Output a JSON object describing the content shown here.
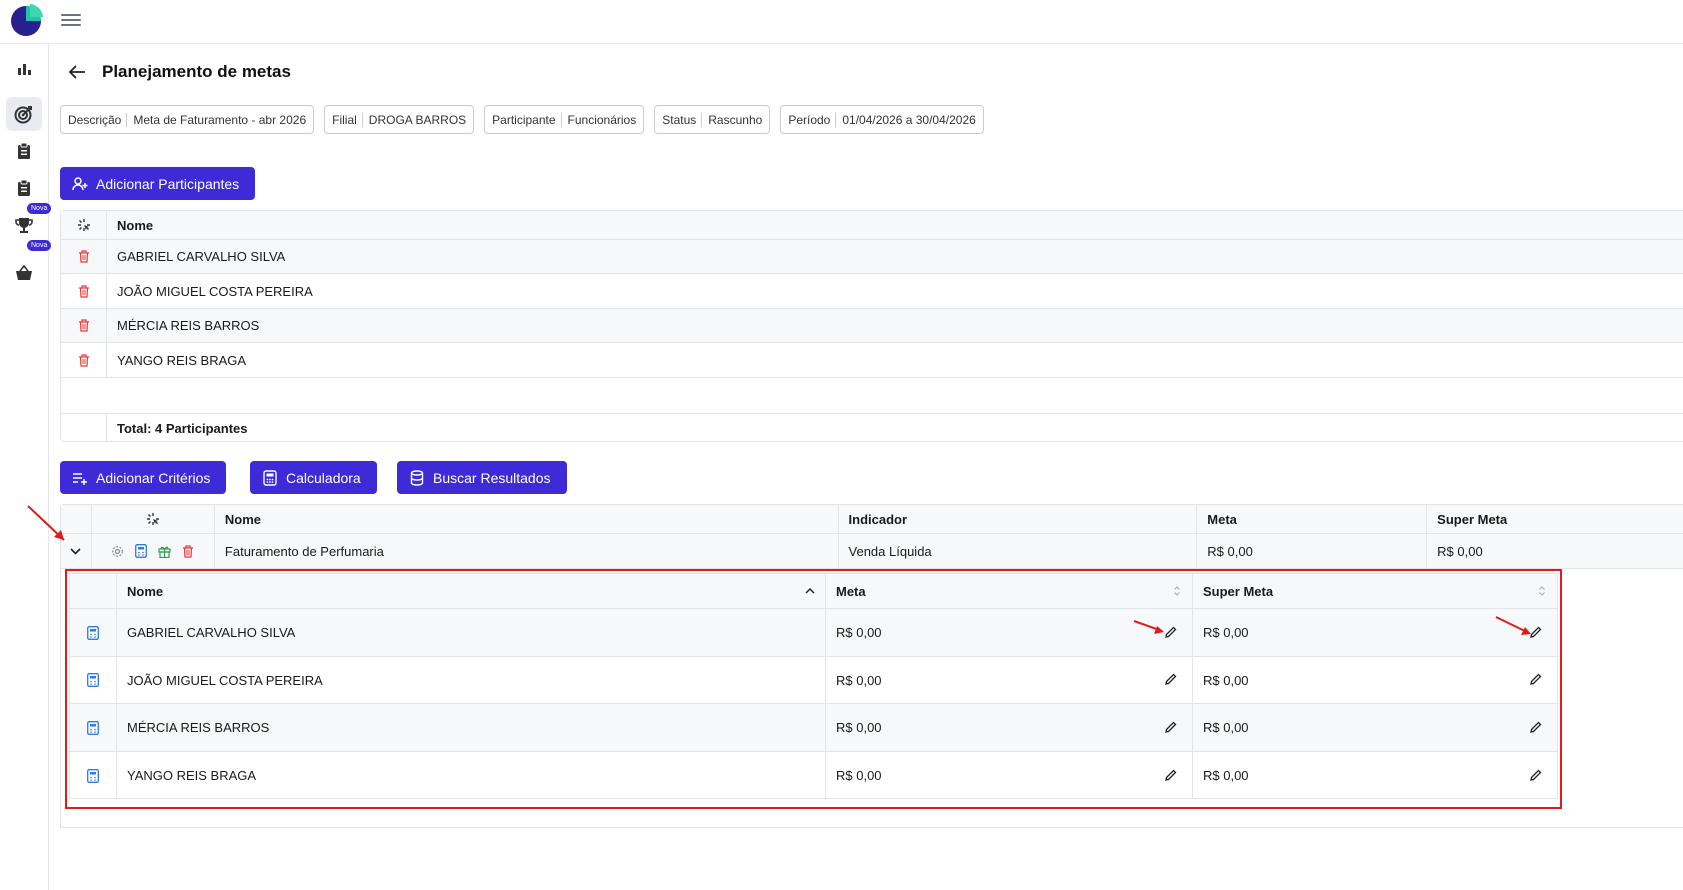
{
  "colors": {
    "primary": "#3d2bd8",
    "danger": "#e53935",
    "highlight": "#e01b1b",
    "calc": "#2b7de0",
    "gift": "#2e9e4f"
  },
  "sidebar": {
    "items": [
      {
        "icon": "bar-chart-icon"
      },
      {
        "icon": "target-icon",
        "active": true
      },
      {
        "icon": "clipboard-icon"
      },
      {
        "icon": "clipboard-icon"
      },
      {
        "icon": "trophy-icon"
      },
      {
        "icon": "basket-icon"
      }
    ],
    "badges": [
      "Nova",
      "Nova"
    ]
  },
  "page": {
    "title": "Planejamento de metas"
  },
  "filters": [
    {
      "label": "Descrição",
      "value": "Meta de Faturamento - abr 2026"
    },
    {
      "label": "Filial",
      "value": "DROGA BARROS"
    },
    {
      "label": "Participante",
      "value": "Funcionários"
    },
    {
      "label": "Status",
      "value": "Rascunho"
    },
    {
      "label": "Período",
      "value": "01/04/2026 a 30/04/2026"
    }
  ],
  "buttons": {
    "add_participants": "Adicionar Participantes",
    "add_criteria": "Adicionar Critérios",
    "calculator": "Calculadora",
    "fetch_results": "Buscar Resultados"
  },
  "participants": {
    "header": "Nome",
    "rows": [
      "GABRIEL CARVALHO SILVA",
      "JOÃO MIGUEL COSTA PEREIRA",
      "MÉRCIA REIS BARROS",
      "YANGO REIS BRAGA"
    ],
    "total": "Total: 4 Participantes"
  },
  "criteria": {
    "headers": {
      "name": "Nome",
      "indicator": "Indicador",
      "goal": "Meta",
      "super_goal": "Super Meta"
    },
    "row": {
      "name": "Faturamento de Perfumaria",
      "indicator": "Venda Líquida",
      "goal": "R$ 0,00",
      "super_goal": "R$ 0,00"
    }
  },
  "subtable": {
    "headers": {
      "name": "Nome",
      "goal": "Meta",
      "super_goal": "Super Meta"
    },
    "rows": [
      {
        "name": "GABRIEL CARVALHO SILVA",
        "goal": "R$ 0,00",
        "super_goal": "R$ 0,00"
      },
      {
        "name": "JOÃO MIGUEL COSTA PEREIRA",
        "goal": "R$ 0,00",
        "super_goal": "R$ 0,00"
      },
      {
        "name": "MÉRCIA REIS BARROS",
        "goal": "R$ 0,00",
        "super_goal": "R$ 0,00"
      },
      {
        "name": "YANGO REIS BRAGA",
        "goal": "R$ 0,00",
        "super_goal": "R$ 0,00"
      }
    ]
  }
}
